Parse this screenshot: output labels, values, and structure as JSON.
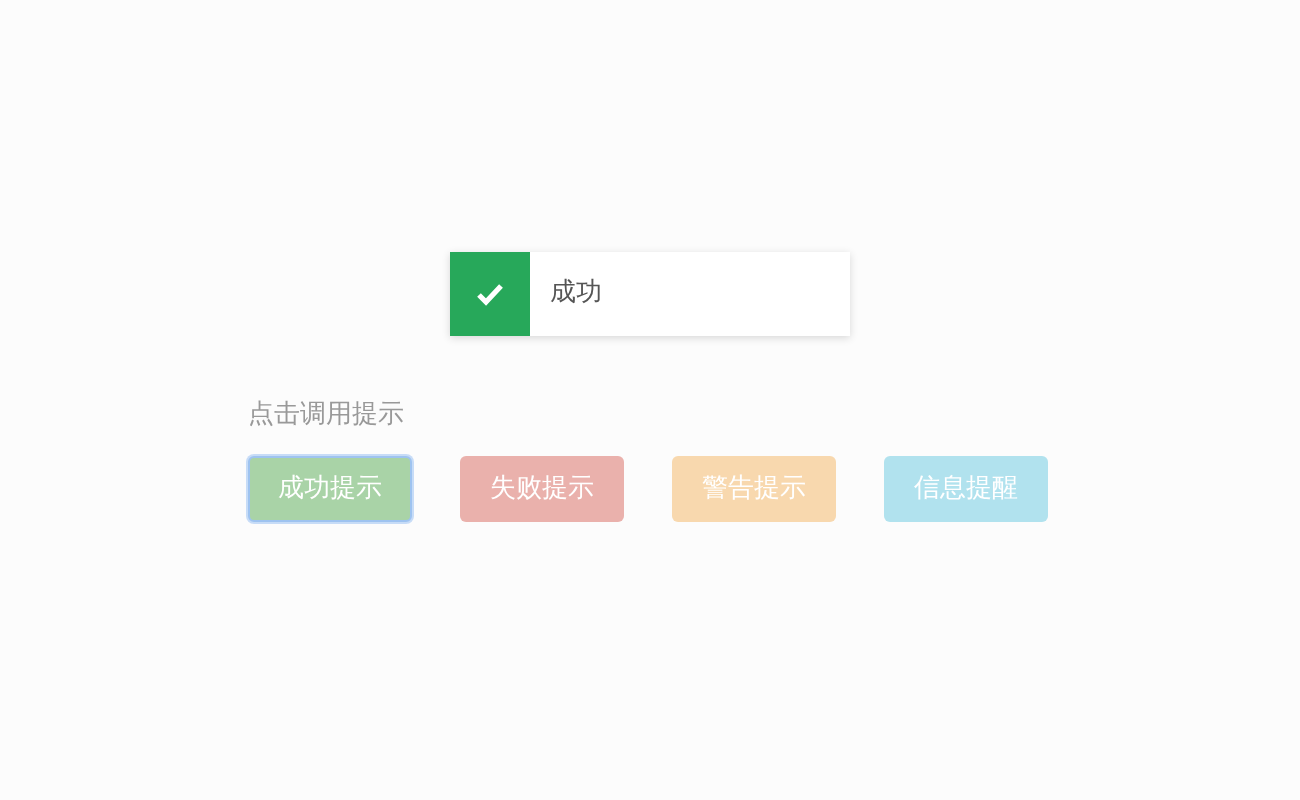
{
  "toast": {
    "kind": "success",
    "message": "成功"
  },
  "prompt_label": "点击调用提示",
  "buttons": [
    {
      "label": "成功提示",
      "color": "#a9d3a7",
      "focused": true
    },
    {
      "label": "失败提示",
      "color": "#eab1ac",
      "focused": false
    },
    {
      "label": "警告提示",
      "color": "#f8d8ae",
      "focused": false
    },
    {
      "label": "信息提醒",
      "color": "#b1e2ee",
      "focused": false
    }
  ]
}
